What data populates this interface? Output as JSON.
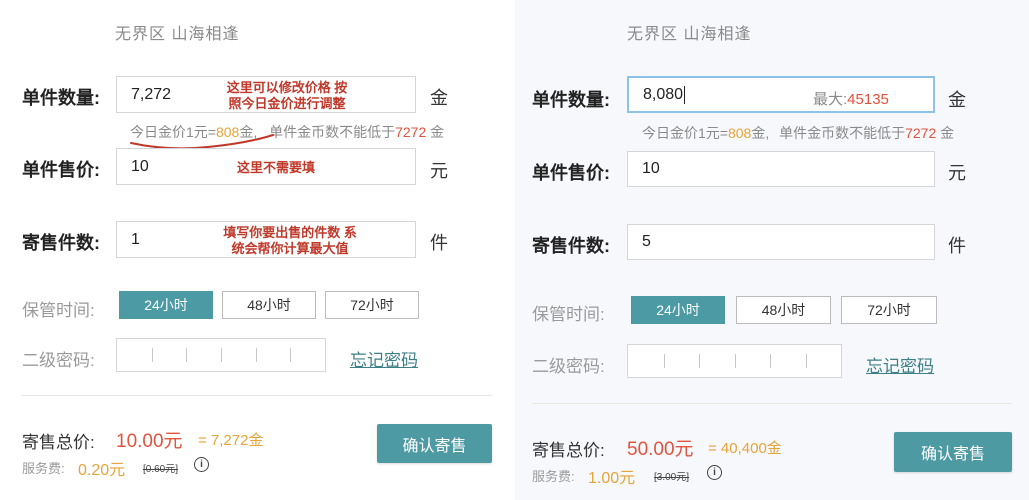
{
  "left": {
    "server": "无界区  山海相逢",
    "qty_label": "单件数量:",
    "qty_value": "7,272",
    "qty_unit": "金",
    "annot_qty": "这里可以修改价格 按\n照今日金价进行调整",
    "rate_prefix": "今日金价1元=",
    "rate_value": "808",
    "rate_suffix": "金,",
    "min_prefix": "单件金币数不能低于",
    "min_value": "7272",
    "min_suffix": " 金",
    "price_label": "单件售价:",
    "price_value": "10",
    "price_unit": "元",
    "annot_price": "这里不需要填",
    "count_label": "寄售件数:",
    "count_value": "1",
    "count_unit": "件",
    "annot_count": "填写你要出售的件数 系\n统会帮你计算最大值",
    "time_label": "保管时间:",
    "time_options": [
      "24小时",
      "48小时",
      "72小时"
    ],
    "pwd_label": "二级密码:",
    "forgot": "忘记密码",
    "total_label": "寄售总价:",
    "total_rmb": "10.00元",
    "total_gold": "= 7,272金",
    "fee_label": "服务费:",
    "fee_value": "0.20元",
    "fee_old": "[0.60元]",
    "info": "i",
    "confirm": "确认寄售"
  },
  "right": {
    "server": "无界区  山海相逢",
    "qty_label": "单件数量:",
    "qty_value": "8,080",
    "max_label": "最大:",
    "max_value": "45135",
    "qty_unit": "金",
    "rate_prefix": "今日金价1元=",
    "rate_value": "808",
    "rate_suffix": "金,",
    "min_prefix": "单件金币数不能低于",
    "min_value": "7272",
    "min_suffix": " 金",
    "price_label": "单件售价:",
    "price_value": "10",
    "price_unit": "元",
    "count_label": "寄售件数:",
    "count_value": "5",
    "count_unit": "件",
    "time_label": "保管时间:",
    "time_options": [
      "24小时",
      "48小时",
      "72小时"
    ],
    "pwd_label": "二级密码:",
    "forgot": "忘记密码",
    "total_label": "寄售总价:",
    "total_rmb": "50.00元",
    "total_gold": "= 40,400金",
    "fee_label": "服务费:",
    "fee_value": "1.00元",
    "fee_old": "[3.00元]",
    "info": "i",
    "confirm": "确认寄售"
  },
  "colors": {
    "accent": "#4c9aa4",
    "gold": "#e6a43a",
    "red": "#e0533f",
    "annotation": "#c0392b"
  }
}
